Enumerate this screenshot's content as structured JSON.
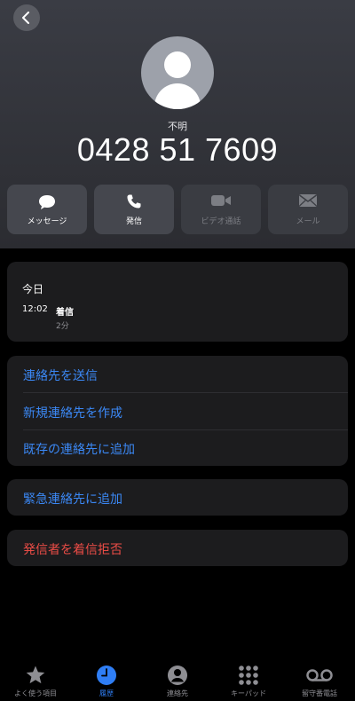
{
  "header": {
    "caller_label": "不明",
    "phone_number": "0428 51 7609"
  },
  "actions": [
    {
      "label": "メッセージ",
      "icon": "message-bubble-icon",
      "enabled": true
    },
    {
      "label": "発信",
      "icon": "phone-icon",
      "enabled": true
    },
    {
      "label": "ビデオ通話",
      "icon": "video-camera-icon",
      "enabled": false
    },
    {
      "label": "メール",
      "icon": "envelope-icon",
      "enabled": false
    }
  ],
  "history": {
    "title": "今日",
    "time": "12:02",
    "type": "着信",
    "duration": "2分"
  },
  "contact_actions": {
    "share": "連絡先を送信",
    "create_new": "新規連絡先を作成",
    "add_existing": "既存の連絡先に追加"
  },
  "emergency": {
    "add": "緊急連絡先に追加"
  },
  "block": {
    "label": "発信者を着信拒否"
  },
  "tabbar": [
    {
      "label": "よく使う項目",
      "icon": "star-icon",
      "active": false
    },
    {
      "label": "履歴",
      "icon": "clock-icon",
      "active": true
    },
    {
      "label": "連絡先",
      "icon": "person-circle-icon",
      "active": false
    },
    {
      "label": "キーパッド",
      "icon": "keypad-icon",
      "active": false
    },
    {
      "label": "留守番電話",
      "icon": "voicemail-icon",
      "active": false
    }
  ],
  "colors": {
    "accent_blue": "#3b88f5",
    "destructive_red": "#ea4c46",
    "tab_active": "#2f7ef5"
  }
}
